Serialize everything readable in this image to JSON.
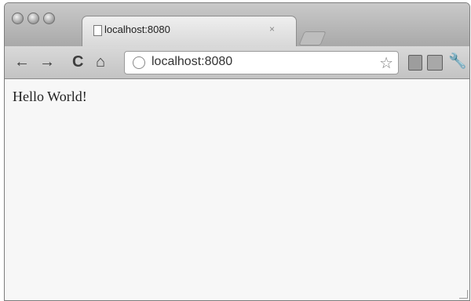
{
  "tab": {
    "title": "localhost:8080",
    "close": "×"
  },
  "toolbar": {
    "back": "←",
    "forward": "→",
    "reload": "C",
    "home": "⌂",
    "url": "localhost:8080",
    "bookmark": "☆",
    "wrench": "🔧"
  },
  "page": {
    "text": "Hello World!"
  }
}
